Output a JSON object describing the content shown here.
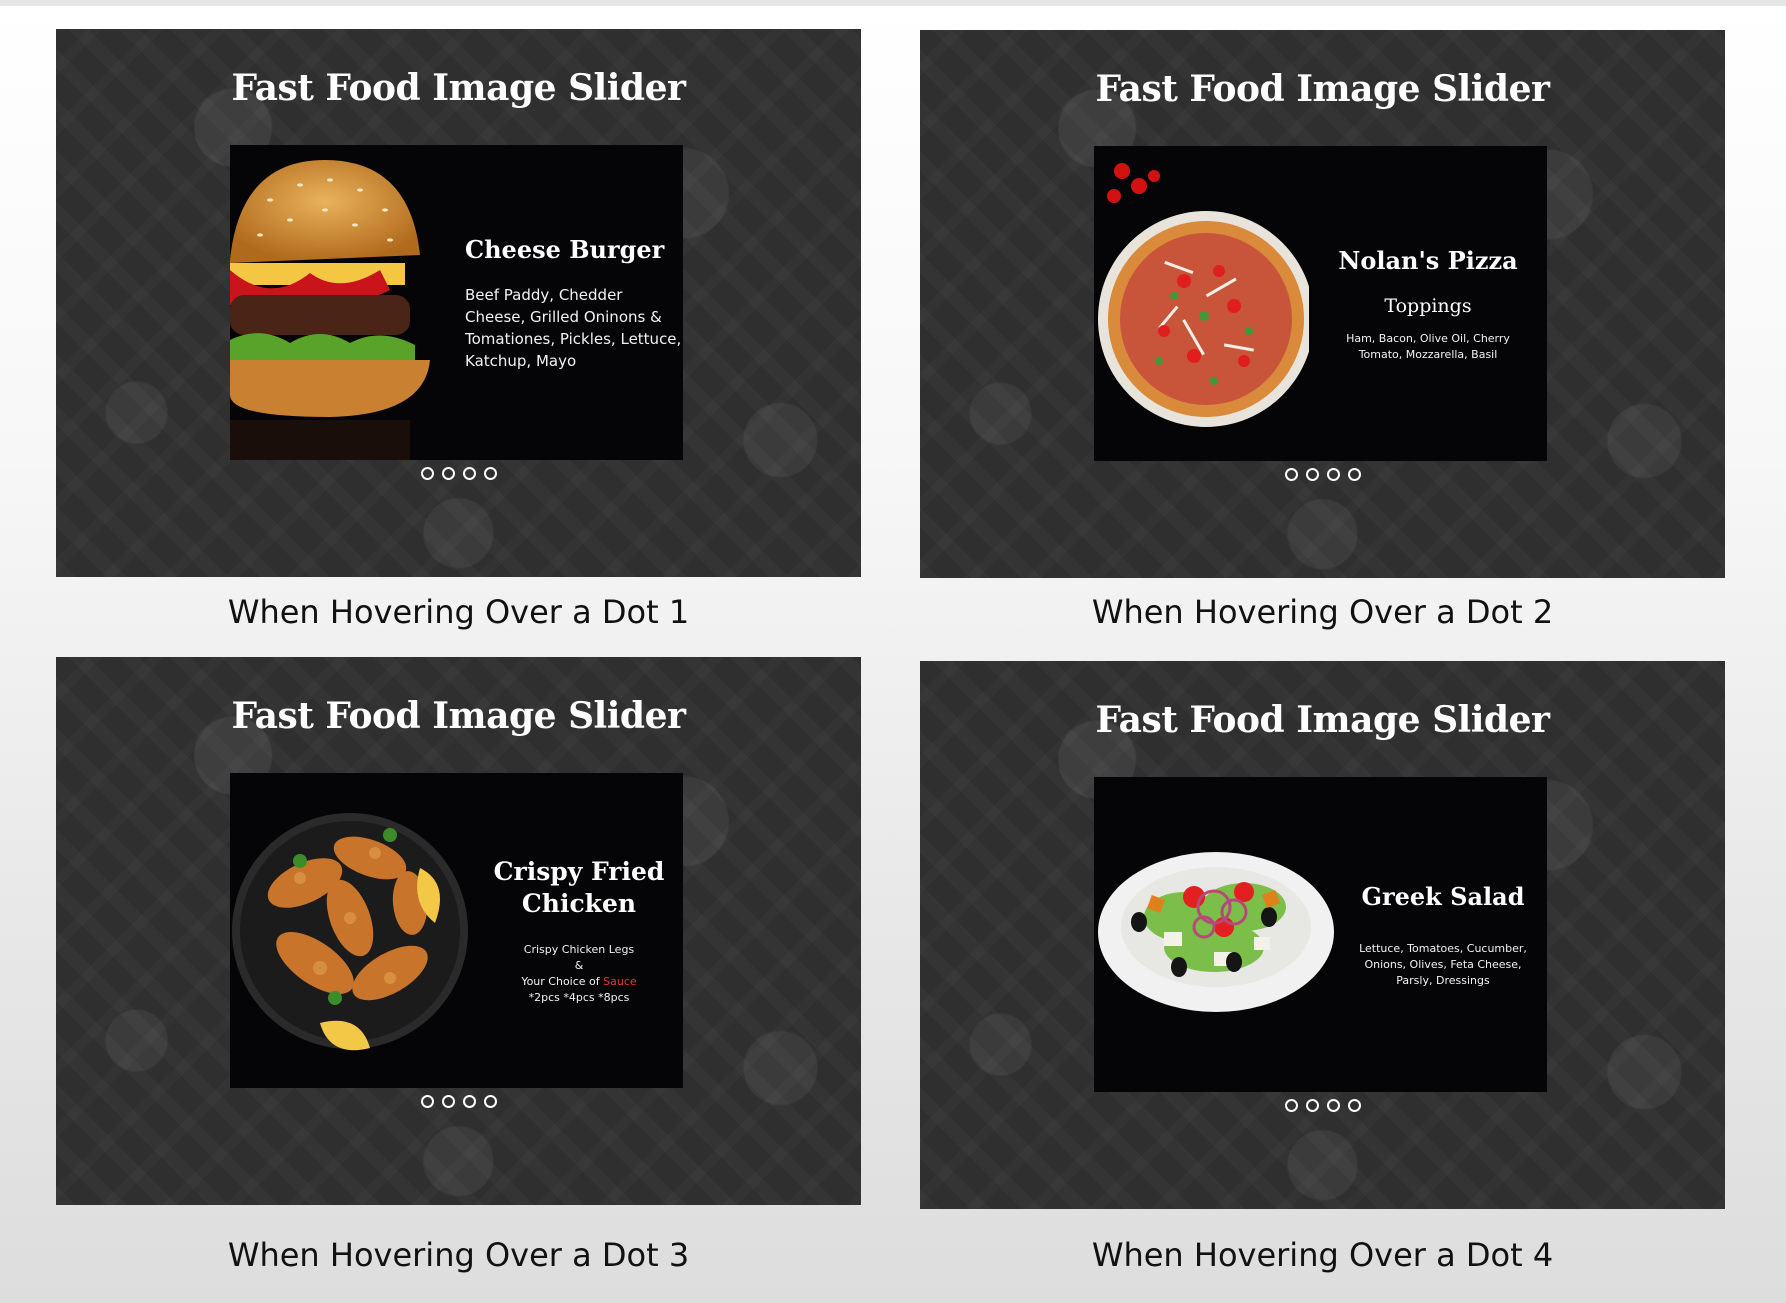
{
  "slider_title": "Fast Food Image Slider",
  "accent_color": "#e53935",
  "panels": [
    {
      "caption": "When Hovering Over a Dot 1",
      "item_name": "Cheese Burger",
      "description": "Beef Paddy, Chedder Cheese, Grilled Oninons & Tomationes, Pickles, Lettuce, Katchup, Mayo",
      "image_icon": "burger-image",
      "dots": 4
    },
    {
      "caption": "When Hovering Over a Dot 2",
      "item_name": "Nolan's Pizza",
      "subheading": "Toppings",
      "description": "Ham, Bacon, Olive Oil, Cherry Tomato, Mozzarella, Basil",
      "image_icon": "pizza-image",
      "dots": 4
    },
    {
      "caption": "When Hovering Over a Dot 3",
      "item_name": "Crispy Fried Chicken",
      "desc_line1": "Crispy Chicken Legs",
      "desc_line2": "&",
      "desc_line3_prefix": "Your Choice of",
      "desc_line3_accent": "Sauce",
      "desc_line4": "*2pcs *4pcs *8pcs",
      "image_icon": "fried-chicken-image",
      "dots": 4
    },
    {
      "caption": "When Hovering Over a Dot 4",
      "item_name": "Greek Salad",
      "description": "Lettuce, Tomatoes, Cucumber, Onions, Olives, Feta Cheese, Parsly, Dressings",
      "image_icon": "greek-salad-image",
      "dots": 4
    }
  ]
}
